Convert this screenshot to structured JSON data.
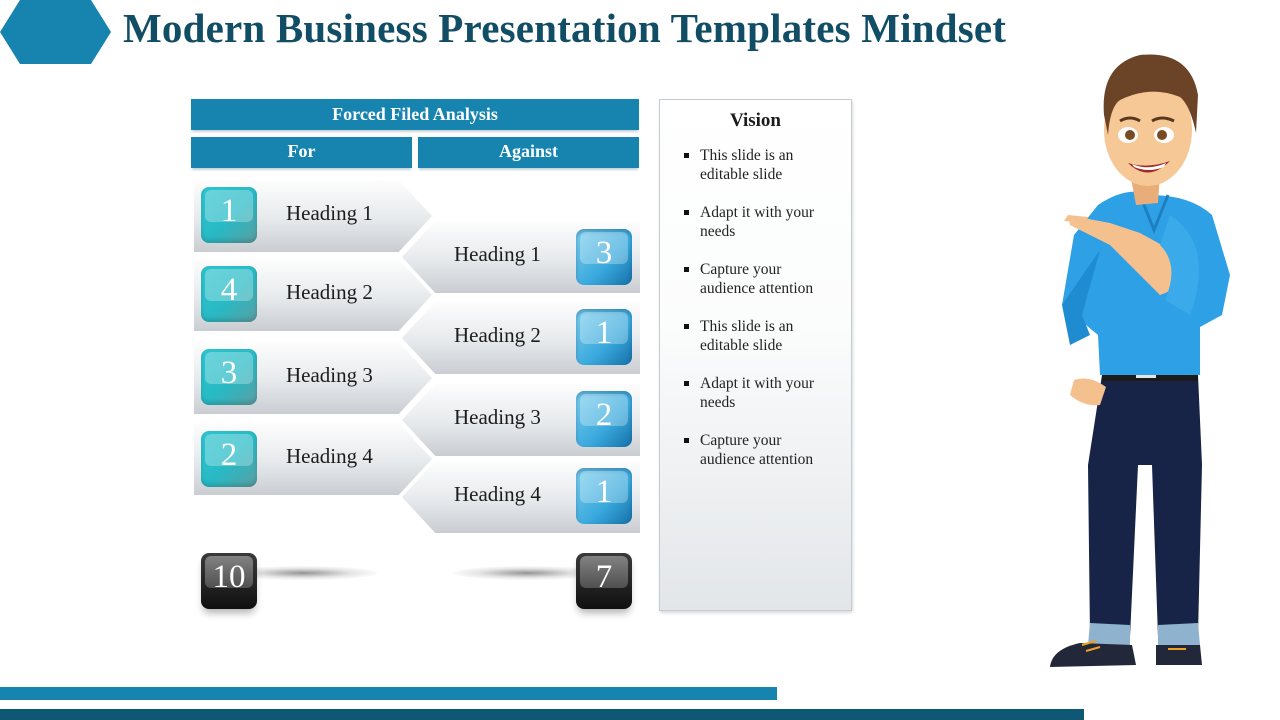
{
  "slide": {
    "title": "Modern Business Presentation Templates Mindset"
  },
  "analysis": {
    "title": "Forced Filed Analysis",
    "for_label": "For",
    "against_label": "Against",
    "for_items": [
      {
        "label": "Heading 1",
        "score": "1"
      },
      {
        "label": "Heading 2",
        "score": "4"
      },
      {
        "label": "Heading 3",
        "score": "3"
      },
      {
        "label": "Heading 4",
        "score": "2"
      }
    ],
    "against_items": [
      {
        "label": "Heading 1",
        "score": "3"
      },
      {
        "label": "Heading 2",
        "score": "1"
      },
      {
        "label": "Heading 3",
        "score": "2"
      },
      {
        "label": "Heading 4",
        "score": "1"
      }
    ],
    "for_total": "10",
    "against_total": "7"
  },
  "vision": {
    "title": "Vision",
    "bullets": [
      "This slide is an editable slide",
      "Adapt it with your needs",
      "Capture your audience attention",
      "This slide is an editable slide",
      "Adapt it with your needs",
      "Capture your audience attention"
    ]
  },
  "colors": {
    "accent": "#1784b0",
    "accent_dark": "#0f5873",
    "title_text": "#124d66",
    "for_badge": "#2ec4cf",
    "against_badge": "#39a8dc"
  }
}
